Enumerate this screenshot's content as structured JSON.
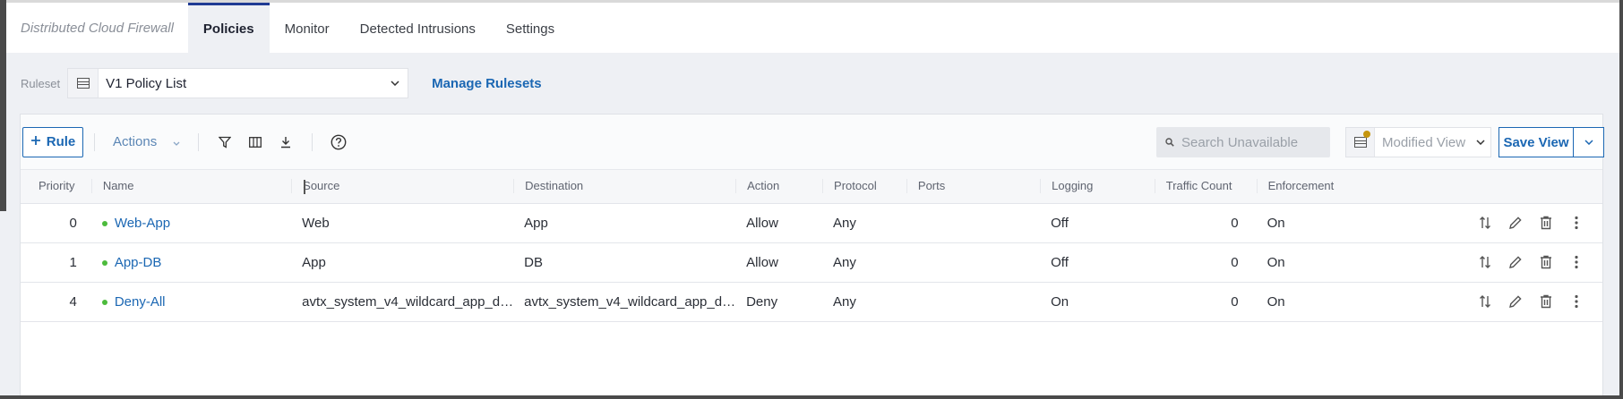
{
  "app": {
    "title": "Distributed Cloud Firewall",
    "tabs": [
      {
        "label": "Policies",
        "active": true
      },
      {
        "label": "Monitor",
        "active": false
      },
      {
        "label": "Detected Intrusions",
        "active": false
      },
      {
        "label": "Settings",
        "active": false
      }
    ]
  },
  "ruleset": {
    "label": "Ruleset",
    "value": "V1 Policy List",
    "manage_label": "Manage Rulesets"
  },
  "toolbar": {
    "add_rule_label": "Rule",
    "actions_label": "Actions",
    "search_placeholder": "Search Unavailable",
    "view_value": "Modified View",
    "save_view_label": "Save View"
  },
  "table": {
    "columns": [
      "Priority",
      "Name",
      "Source",
      "Destination",
      "Action",
      "Protocol",
      "Ports",
      "Logging",
      "Traffic Count",
      "Enforcement"
    ],
    "rows": [
      {
        "priority": "0",
        "name": "Web-App",
        "source": "Web",
        "destination": "App",
        "action": "Allow",
        "protocol": "Any",
        "ports": "",
        "logging": "Off",
        "traffic": "0",
        "enforcement": "On"
      },
      {
        "priority": "1",
        "name": "App-DB",
        "source": "App",
        "destination": "DB",
        "action": "Allow",
        "protocol": "Any",
        "ports": "",
        "logging": "Off",
        "traffic": "0",
        "enforcement": "On"
      },
      {
        "priority": "4",
        "name": "Deny-All",
        "source": "avtx_system_v4_wildcard_app_d…",
        "destination": "avtx_system_v4_wildcard_app_d…",
        "action": "Deny",
        "protocol": "Any",
        "ports": "",
        "logging": "On",
        "traffic": "0",
        "enforcement": "On"
      }
    ]
  },
  "colors": {
    "accent": "#1b67b3",
    "status_dot": "#4cbb3c",
    "modified_indicator": "#c5950d",
    "active_tab_border": "#1f3a93"
  }
}
